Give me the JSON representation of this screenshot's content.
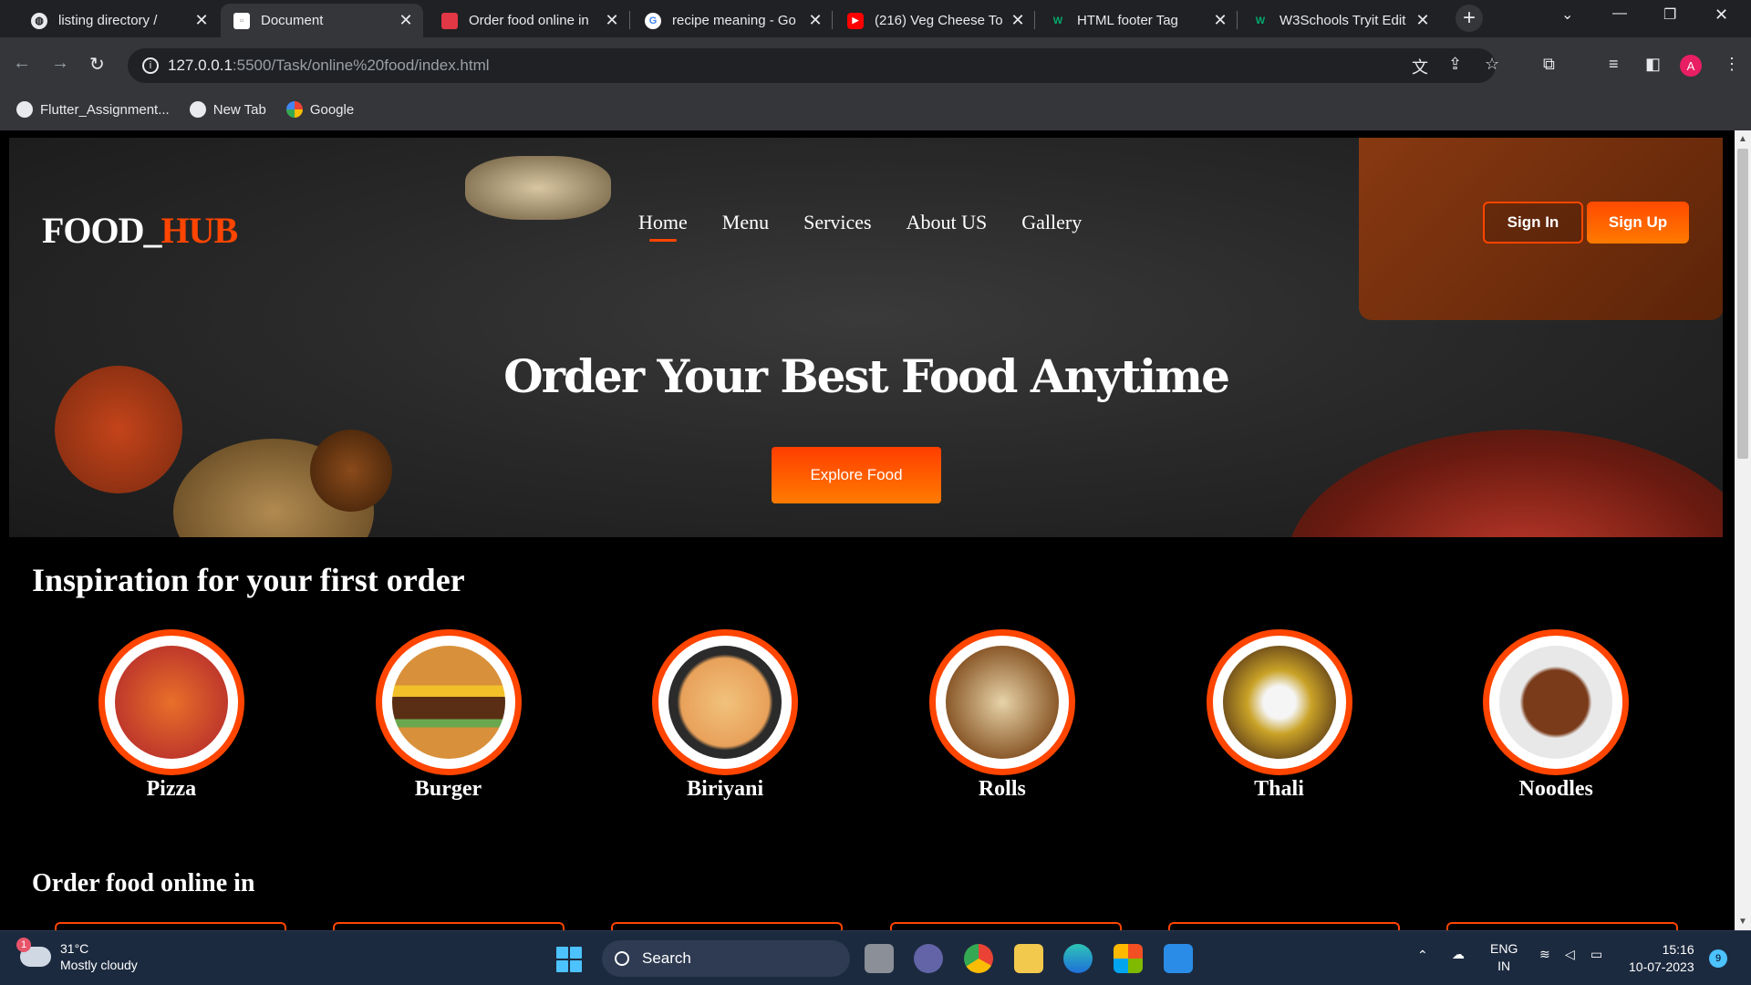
{
  "browser": {
    "tabs": [
      {
        "title": "listing directory /",
        "favicon": "globe-icon",
        "active": false
      },
      {
        "title": "Document",
        "favicon": "page-icon",
        "active": true
      },
      {
        "title": "Order food online in",
        "favicon": "zomato-icon",
        "active": false
      },
      {
        "title": "recipe meaning - Go",
        "favicon": "google-icon",
        "active": false
      },
      {
        "title": "(216) Veg Cheese To",
        "favicon": "youtube-icon",
        "active": false
      },
      {
        "title": "HTML footer Tag",
        "favicon": "w3schools-icon",
        "active": false
      },
      {
        "title": "W3Schools Tryit Edit",
        "favicon": "w3schools-icon",
        "active": false
      }
    ],
    "url_host": "127.0.0.1",
    "url_path": ":5500/Task/online%20food/index.html",
    "profile_initial": "A",
    "bookmarks": [
      {
        "label": "Flutter_Assignment...",
        "icon": "github-icon"
      },
      {
        "label": "New Tab",
        "icon": "globe-icon"
      },
      {
        "label": "Google",
        "icon": "google-icon"
      }
    ]
  },
  "site": {
    "logo_main": "FOOD_",
    "logo_accent": "HUB",
    "nav": [
      "Home",
      "Menu",
      "Services",
      "About US",
      "Gallery"
    ],
    "active_nav": "Home",
    "signin_label": "Sign In",
    "signup_label": "Sign Up",
    "hero_title": "Order Your Best Food Anytime",
    "explore_label": "Explore Food",
    "inspiration_title": "Inspiration for your first order",
    "categories": [
      {
        "label": "Pizza",
        "color": "#d2691e"
      },
      {
        "label": "Burger",
        "color": "#b5651d"
      },
      {
        "label": "Biriyani",
        "color": "#e8a15a"
      },
      {
        "label": "Rolls",
        "color": "#8b5a2b"
      },
      {
        "label": "Thali",
        "color": "#c9a227"
      },
      {
        "label": "Noodles",
        "color": "#7a3b1a"
      }
    ],
    "order_online_title": "Order food online in",
    "accent_color": "#ff4500"
  },
  "taskbar": {
    "weather_temp": "31°C",
    "weather_desc": "Mostly cloudy",
    "weather_badge": "1",
    "search_label": "Search",
    "lang_top": "ENG",
    "lang_bottom": "IN",
    "time": "15:16",
    "date": "10-07-2023",
    "notification_count": "9"
  }
}
